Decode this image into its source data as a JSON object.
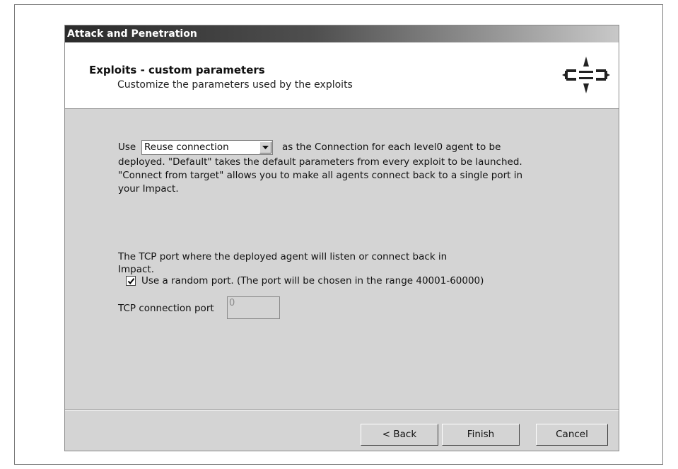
{
  "window": {
    "title": "Attack and Penetration"
  },
  "header": {
    "title": "Exploits - custom parameters",
    "subtitle": "Customize the parameters used by the exploits",
    "icon": "crosshair-target-icon"
  },
  "connection": {
    "prefix": "Use",
    "selected": "Reuse connection",
    "suffix": "as the Connection for each level0 agent to be",
    "line2": "deployed. \"Default\" takes the default parameters from every exploit to be launched.",
    "line3": "\"Connect from target\" allows you to make all agents connect back to a single port in",
    "line4": "your Impact."
  },
  "port": {
    "description_line1": "The TCP port where the deployed agent will listen or connect back in",
    "description_line2": "Impact.",
    "random_checkbox_label": "Use a random port. (The port will be chosen in the range 40001-60000)",
    "random_checked": true,
    "field_label": "TCP connection port",
    "field_value": "0"
  },
  "buttons": {
    "back": "< Back",
    "finish": "Finish",
    "cancel": "Cancel"
  }
}
